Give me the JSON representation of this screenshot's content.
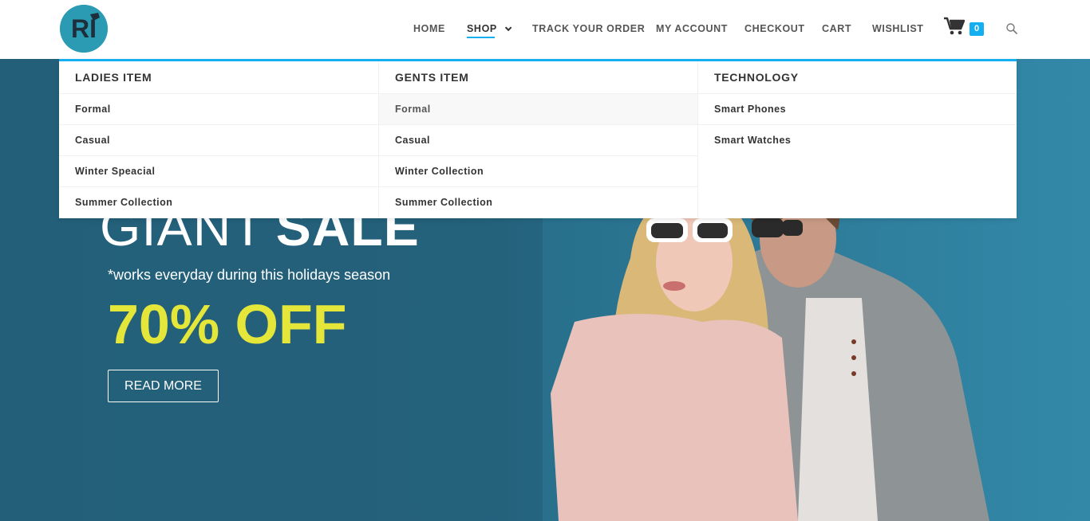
{
  "header": {
    "logo_text": "RI",
    "nav": [
      {
        "label": "HOME"
      },
      {
        "label": "SHOP"
      },
      {
        "label": "TRACK YOUR ORDER"
      },
      {
        "label": "MY ACCOUNT"
      },
      {
        "label": "CHECKOUT"
      },
      {
        "label": "CART"
      },
      {
        "label": "WISHLIST"
      }
    ],
    "cart_count": "0"
  },
  "mega_menu": {
    "columns": [
      {
        "heading": "LADIES ITEM",
        "links": [
          "Formal",
          "Casual",
          "Winter Speacial",
          "Summer Collection"
        ]
      },
      {
        "heading": "GENTS ITEM",
        "links": [
          "Formal",
          "Casual",
          "Winter Collection",
          "Summer Collection"
        ]
      },
      {
        "heading": "TECHNOLOGY",
        "links": [
          "Smart Phones",
          "Smart Watches"
        ]
      }
    ]
  },
  "hero": {
    "title_light": "GIANT",
    "title_bold": "SALE",
    "subtitle": "*works everyday during this holidays season",
    "discount": "70% OFF",
    "button_label": "READ MORE"
  },
  "colors": {
    "accent": "#13aff0",
    "hero_bg": "#24617b",
    "discount": "#e4e63a"
  }
}
